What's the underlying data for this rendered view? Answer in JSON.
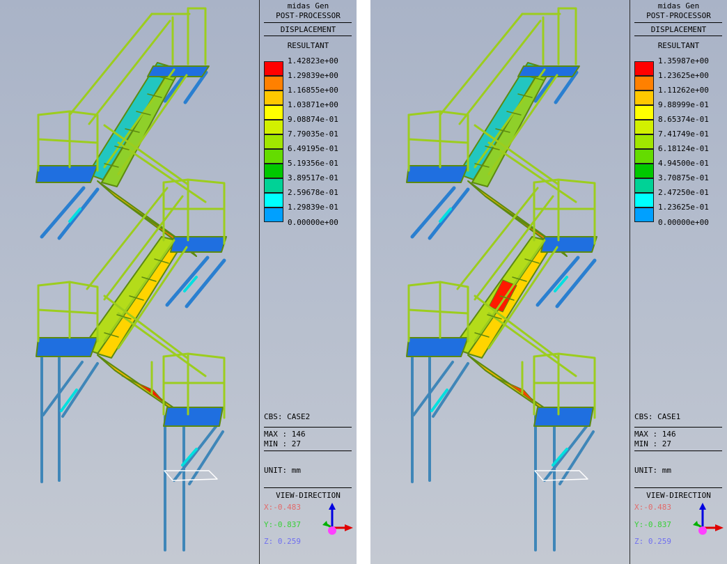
{
  "panels": [
    {
      "app_name": "midas Gen",
      "mode": "POST-PROCESSOR",
      "result_type": "DISPLACEMENT",
      "component": "RESULTANT",
      "legend_values": [
        "1.42823e+00",
        "1.29839e+00",
        "1.16855e+00",
        "1.03871e+00",
        "9.08874e-01",
        "7.79035e-01",
        "6.49195e-01",
        "5.19356e-01",
        "3.89517e-01",
        "2.59678e-01",
        "1.29839e-01",
        "0.00000e+00"
      ],
      "cbs": "CBS: CASE2",
      "max": "MAX : 146",
      "min": "MIN : 27",
      "unit": "UNIT: mm",
      "view_direction_label": "VIEW-DIRECTION",
      "view_x": "X:-0.483",
      "view_y": "Y:-0.837",
      "view_z": "Z: 0.259"
    },
    {
      "app_name": "midas Gen",
      "mode": "POST-PROCESSOR",
      "result_type": "DISPLACEMENT",
      "component": "RESULTANT",
      "legend_values": [
        "1.35987e+00",
        "1.23625e+00",
        "1.11262e+00",
        "9.88999e-01",
        "8.65374e-01",
        "7.41749e-01",
        "6.18124e-01",
        "4.94500e-01",
        "3.70875e-01",
        "2.47250e-01",
        "1.23625e-01",
        "0.00000e+00"
      ],
      "cbs": "CBS: CASE1",
      "max": "MAX : 146",
      "min": "MIN : 27",
      "unit": "UNIT: mm",
      "view_direction_label": "VIEW-DIRECTION",
      "view_x": "X:-0.483",
      "view_y": "Y:-0.837",
      "view_z": "Z: 0.259"
    }
  ],
  "legend_colors": [
    "#ff0000",
    "#ff8000",
    "#ffc800",
    "#ffff00",
    "#d2f000",
    "#a0e600",
    "#64dc00",
    "#00c800",
    "#00d296",
    "#00ffff",
    "#00a0ff",
    "#0064ff"
  ],
  "structure_colors": {
    "frame": "#9ccd1e",
    "frame_dark": "#5c8a10",
    "column": "#3f86b8",
    "brace": "#2a7fd0",
    "landing": "#1f6fe0",
    "hot": "#ff1a00"
  },
  "triad_colors": {
    "x": "#e00000",
    "y": "#00b000",
    "z": "#0000e0",
    "origin": "#ff40ff"
  }
}
